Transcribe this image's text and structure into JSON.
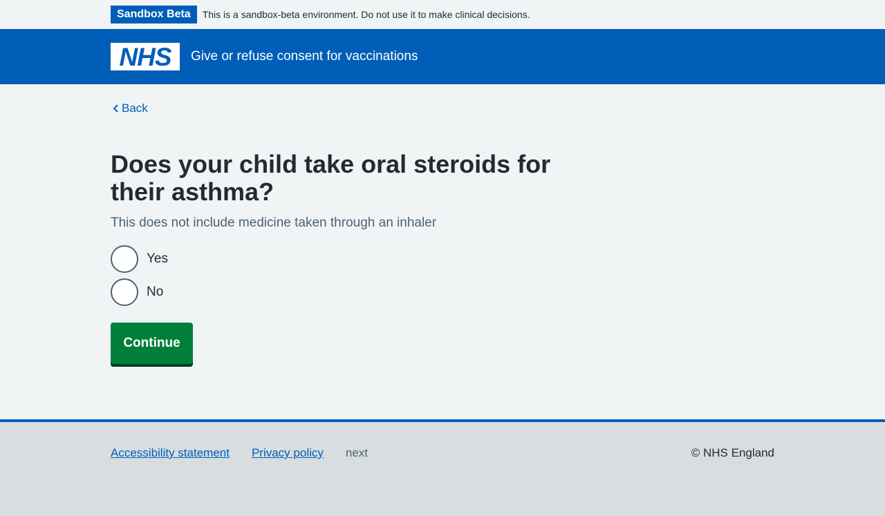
{
  "phase_banner": {
    "tag": "Sandbox Beta",
    "text": "This is a sandbox-beta environment. Do not use it to make clinical decisions."
  },
  "header": {
    "logo_text": "NHS",
    "service_name": "Give or refuse consent for vaccinations",
    "brand_color": "#005eb8"
  },
  "back_link": {
    "label": "Back",
    "icon": "chevron-left-icon"
  },
  "question": {
    "title": "Does your child take oral steroids for their asthma?",
    "hint": "This does not include medicine taken through an inhaler",
    "options": [
      {
        "label": "Yes",
        "selected": false
      },
      {
        "label": "No",
        "selected": false
      }
    ]
  },
  "continue_button": {
    "label": "Continue",
    "color": "#007f3b"
  },
  "footer": {
    "links": [
      "Accessibility statement",
      "Privacy policy"
    ],
    "plain_text": "next",
    "copyright": "© NHS England"
  }
}
